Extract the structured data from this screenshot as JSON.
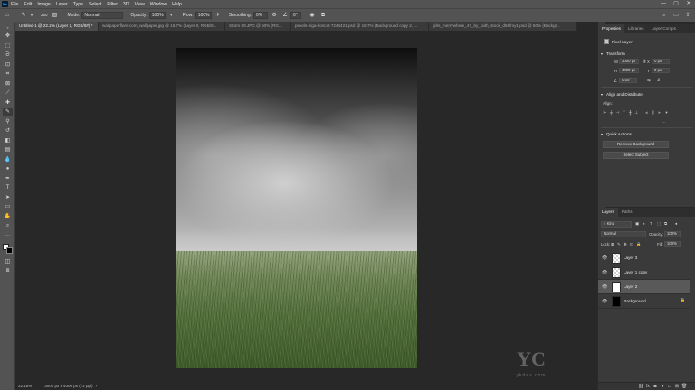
{
  "menubar": {
    "logo": "Ps",
    "items": [
      "File",
      "Edit",
      "Image",
      "Layer",
      "Type",
      "Select",
      "Filter",
      "3D",
      "View",
      "Window",
      "Help"
    ],
    "minimize": "—",
    "maximize": "▢",
    "close": "✕"
  },
  "options": {
    "brush_size": "250",
    "mode_label": "Mode:",
    "mode_value": "Normal",
    "opacity_label": "Opacity:",
    "opacity_value": "100%",
    "flow_label": "Flow:",
    "flow_value": "100%",
    "smoothing_label": "Smoothing:",
    "smoothing_value": "0%",
    "angle_value": "0°"
  },
  "tabs": [
    {
      "label": "Untitled-1 @ 22.2% (Layer 2, RGB/8#) *",
      "active": true
    },
    {
      "label": "wallpaperflare.com_wallpaper.jpg @ 16.7% (Layer 0, RGB/8...",
      "active": false
    },
    {
      "label": "Storm 69.JPG @ 50% (RG...",
      "active": false
    },
    {
      "label": "pexels-olga-lioncat-7244421.psd @ 16.7% (Background copy 2, ...",
      "active": false
    },
    {
      "label": "girls_merrywhere_47_by_faith_stock_d58fmy1.psd @ 50% (Backgr...",
      "active": false
    }
  ],
  "status": {
    "zoom": "22.18%",
    "dimensions": "3000 px x 4000 px (72 ppi)"
  },
  "properties": {
    "tabs": [
      "Properties",
      "Libraries",
      "Layer Comps"
    ],
    "layer_type": "Pixel Layer",
    "transform_title": "Transform",
    "w_label": "W",
    "w_value": "3000 px",
    "h_label": "H",
    "h_value": "4000 px",
    "x_label": "X",
    "x_value": "0 px",
    "y_label": "Y",
    "y_value": "0 px",
    "angle_value": "0.00°",
    "align_title": "Align and Distribute",
    "align_label": "Align:",
    "quick_title": "Quick Actions",
    "remove_bg": "Remove Background",
    "select_subject": "Select Subject"
  },
  "layers_panel": {
    "tabs": [
      "Layers",
      "Paths"
    ],
    "kind_label": "Kind",
    "blend_mode": "Normal",
    "opacity_label": "Opacity:",
    "opacity_value": "100%",
    "lock_label": "Lock:",
    "fill_label": "Fill:",
    "fill_value": "100%",
    "layers": [
      {
        "name": "Layer 3",
        "thumb": "transparent",
        "selected": false
      },
      {
        "name": "Layer 1 copy",
        "thumb": "transparent",
        "selected": false
      },
      {
        "name": "Layer 2",
        "thumb": "white",
        "selected": true
      },
      {
        "name": "Background",
        "thumb": "black",
        "selected": false
      }
    ]
  },
  "watermark": {
    "mark": "YC",
    "text": "ykdes.com"
  },
  "colors": {
    "app_bg": "#282828",
    "panel_bg": "#3a3a3a",
    "bar_bg": "#535353",
    "selection": "#595959"
  }
}
